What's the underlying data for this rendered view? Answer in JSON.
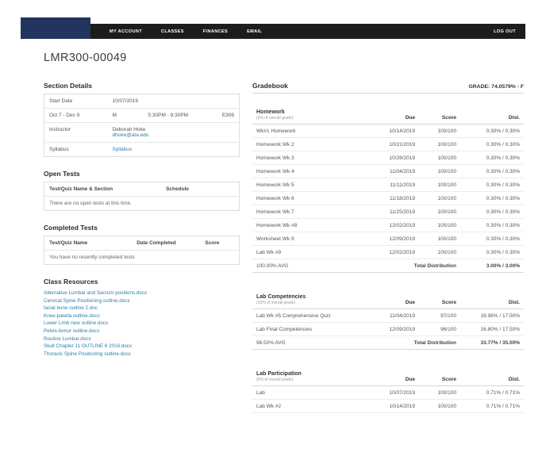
{
  "colors": {
    "nav_bg": "#1c1c1c",
    "logo_bg": "#23355e",
    "link": "#2e7ea6"
  },
  "nav": {
    "items": [
      "MY ACCOUNT",
      "CLASSES",
      "FINANCES",
      "EMAIL"
    ],
    "logout_label": "LOG OUT"
  },
  "page_title": "LMR300-00049",
  "section_details": {
    "heading": "Section Details",
    "start_date_label": "Start Date",
    "start_date_value": "10/07/2019",
    "schedule_range": "Oct 7 - Dec 9",
    "schedule_day": "M",
    "schedule_time": "5:30PM - 9:30PM",
    "schedule_room": "E306",
    "instructor_label": "Instructor",
    "instructor_name": "Deborah Hoke",
    "instructor_email": "dhoke@ata.edu",
    "syllabus_label": "Syllabus",
    "syllabus_link": "Syllabus"
  },
  "open_tests": {
    "heading": "Open Tests",
    "col_name": "Test/Quiz Name & Section",
    "col_schedule": "Schedule",
    "empty_message": "There are no open tests at this time."
  },
  "completed_tests": {
    "heading": "Completed Tests",
    "col_name": "Test/Quiz Name",
    "col_date": "Date Completed",
    "col_score": "Score",
    "empty_message": "You have no recently completed tests"
  },
  "class_resources": {
    "heading": "Class Resources",
    "files": [
      "Alternative Lumbar and Sacrum positions.docx",
      "Cervical Spine Positioning outline.docx",
      "facial bone outline 2.doc",
      "Knee-patella outline.docx",
      "Lower Limb new outline.docx",
      "Pelvis-femur outline.docx",
      "Routine Lumbar.docx",
      "Skull Chapter 11 OUTLINE 6 2016.docx",
      "Thoracic Spine Positioning outline.docx"
    ]
  },
  "gradebook": {
    "heading": "Gradebook",
    "grade_label": "GRADE: 74.0579% - F",
    "homework": {
      "title": "Homework",
      "subtitle": "(3% of overall grade)",
      "col_due": "Due",
      "col_score": "Score",
      "col_dist": "Dist.",
      "rows": [
        {
          "name": "Wk#1 Homework",
          "due": "10/14/2019",
          "score": "100/100",
          "dist": "0.30% / 0.30%"
        },
        {
          "name": "Homework Wk 2",
          "due": "10/21/2019",
          "score": "100/100",
          "dist": "0.30% / 0.30%"
        },
        {
          "name": "Homework Wk 3",
          "due": "10/28/2019",
          "score": "100/100",
          "dist": "0.30% / 0.30%"
        },
        {
          "name": "Homework Wk 4",
          "due": "11/04/2019",
          "score": "100/100",
          "dist": "0.30% / 0.30%"
        },
        {
          "name": "Homework Wk 5",
          "due": "11/11/2019",
          "score": "100/100",
          "dist": "0.30% / 0.30%"
        },
        {
          "name": "Homework Wk 6",
          "due": "11/18/2019",
          "score": "100/100",
          "dist": "0.30% / 0.30%"
        },
        {
          "name": "Homework Wk 7",
          "due": "11/25/2019",
          "score": "100/100",
          "dist": "0.30% / 0.30%"
        },
        {
          "name": "Homework Wk #8",
          "due": "12/02/2019",
          "score": "100/100",
          "dist": "0.30% / 0.30%"
        },
        {
          "name": "Worksheet Wk 9",
          "due": "12/09/2019",
          "score": "100/100",
          "dist": "0.30% / 0.30%"
        },
        {
          "name": "Lab Wk #9",
          "due": "12/02/2019",
          "score": "100/100",
          "dist": "0.30% / 0.30%"
        }
      ],
      "avg": "100.00% AVG",
      "total_label": "Total Distribution",
      "total_dist": "3.00% / 3.00%"
    },
    "lab_competencies": {
      "title": "Lab Competencies",
      "subtitle": "(35% of overall grade)",
      "col_due": "Due",
      "col_score": "Score",
      "col_dist": "Dist.",
      "rows": [
        {
          "name": "Lab Wk #5 Comprehensive Quiz",
          "due": "11/04/2019",
          "score": "97/100",
          "dist": "16.98% / 17.50%"
        },
        {
          "name": "Lab Final Competencies",
          "due": "12/09/2019",
          "score": "96/100",
          "dist": "16.80% / 17.50%"
        }
      ],
      "avg": "96.50% AVG",
      "total_label": "Total Distribution",
      "total_dist": "33.77% / 35.00%"
    },
    "lab_participation": {
      "title": "Lab Participation",
      "subtitle": "(5% of overall grade)",
      "col_due": "Due",
      "col_score": "Score",
      "col_dist": "Dist.",
      "rows": [
        {
          "name": "Lab",
          "due": "10/07/2019",
          "score": "100/100",
          "dist": "0.71% / 0.71%"
        },
        {
          "name": "Lab Wk #2",
          "due": "10/14/2019",
          "score": "100/100",
          "dist": "0.71% / 0.71%"
        }
      ]
    }
  }
}
